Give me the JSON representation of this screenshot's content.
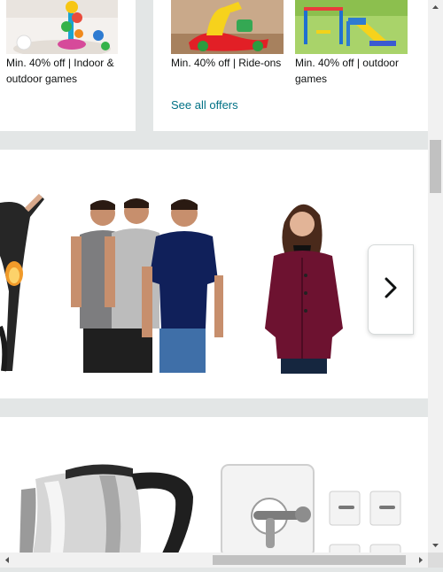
{
  "offers": {
    "left_caption": "Min. 40% off | Indoor & outdoor games",
    "right_items": [
      {
        "caption": "Min. 40% off | Ride-ons"
      },
      {
        "caption": "Min. 40% off | outdoor games"
      }
    ],
    "see_all_label": "See all offers"
  },
  "carousel": {
    "next_icon": "chevron-right-icon"
  },
  "colors": {
    "link": "#007185",
    "page_bg": "#e3e6e6"
  }
}
